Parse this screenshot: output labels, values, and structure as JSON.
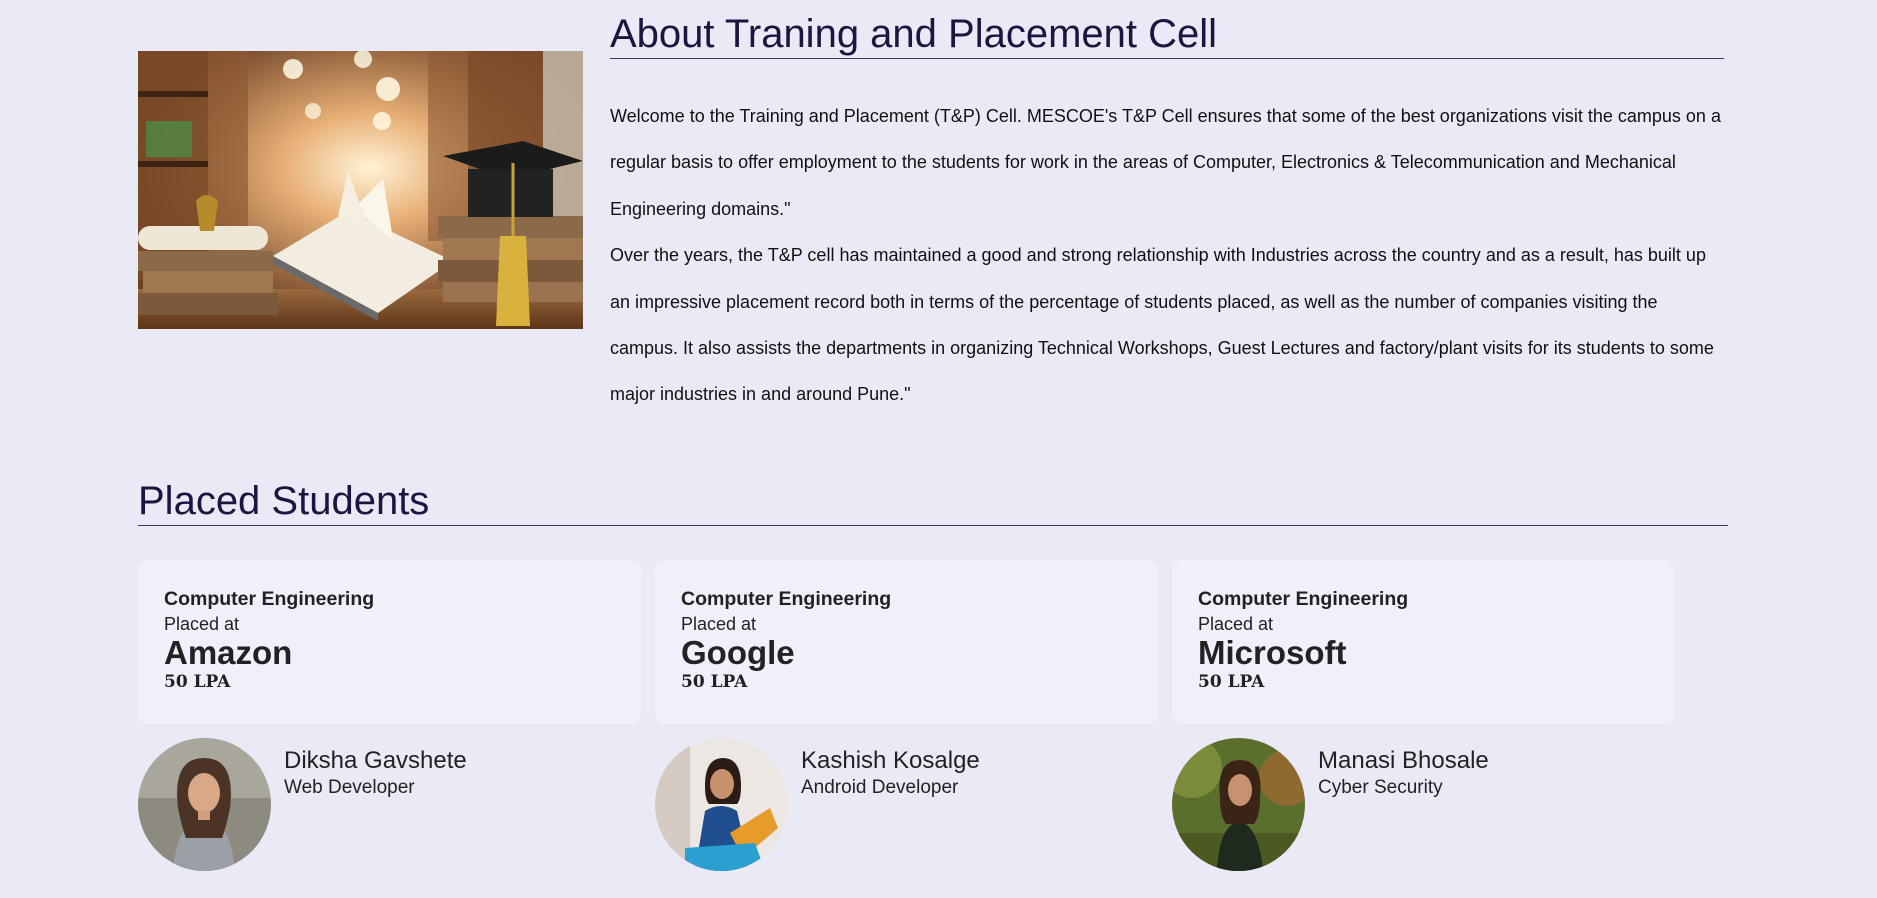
{
  "about": {
    "title": "About Traning and Placement Cell",
    "paragraph1": "Welcome to the Training and Placement (T&P) Cell. MESCOE's T&P Cell ensures that some of the best organizations visit the campus on a regular basis to offer employment to the students for work in the areas of Computer, Electronics & Telecommunication and Mechanical Engineering domains.\"",
    "paragraph2": "Over the years, the T&P cell has maintained a good and strong relationship with Industries across the country and as a result, has built up an impressive placement record both in terms of the percentage of students placed, as well as the number of companies visiting the campus. It also assists the departments in organizing Technical Workshops, Guest Lectures and factory/plant visits for its students to some major industries in and around Pune.\""
  },
  "placed": {
    "title": "Placed Students",
    "students": [
      {
        "department": "Computer Engineering",
        "placed_at_label": "Placed at",
        "company": "Amazon",
        "package": "50 LPA",
        "name": "Diksha Gavshete",
        "role": "Web Developer"
      },
      {
        "department": "Computer Engineering",
        "placed_at_label": "Placed at",
        "company": "Google",
        "package": "50 LPA",
        "name": "Kashish Kosalge",
        "role": "Android Developer"
      },
      {
        "department": "Computer Engineering",
        "placed_at_label": "Placed at",
        "company": "Microsoft",
        "package": "50 LPA",
        "name": "Manasi Bhosale",
        "role": "Cyber Security"
      }
    ]
  },
  "colors": {
    "background": "#eae9f6",
    "card": "#eff0fa",
    "heading": "#1a1640"
  }
}
